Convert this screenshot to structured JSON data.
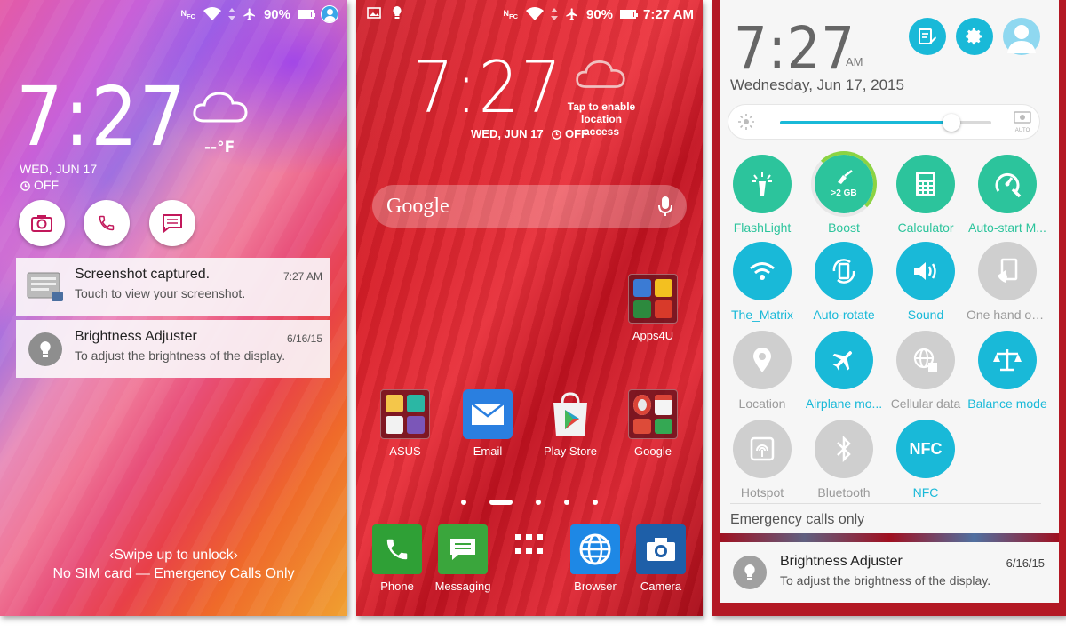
{
  "lockscreen": {
    "status": {
      "battery": "90%",
      "battery_level": 0.9
    },
    "clock": {
      "hour": "7",
      "minutes": "27"
    },
    "weather_temp": "--°F",
    "date": "WED, JUN 17",
    "alarm": "OFF",
    "quick_launch": [
      "camera-icon",
      "phone-icon",
      "message-icon"
    ],
    "notifications": [
      {
        "title": "Screenshot captured.",
        "subtitle": "Touch to view your screenshot.",
        "time": "7:27 AM"
      },
      {
        "title": "Brightness Adjuster",
        "subtitle": "To adjust the brightness of the display.",
        "time": "6/16/15"
      }
    ],
    "swipe_hint": "Swipe up to unlock",
    "sim_status": "No SIM card — Emergency Calls Only"
  },
  "homescreen": {
    "status": {
      "battery": "90%",
      "time": "7:27 AM",
      "battery_level": 0.9
    },
    "clock": {
      "hour": "7",
      "minutes": "27"
    },
    "weather_hint": [
      "Tap to enable",
      "location access"
    ],
    "date": "WED, JUN 17",
    "alarm": "OFF",
    "search_logo": "Google",
    "apps": {
      "apps4u": "Apps4U",
      "asus": "ASUS",
      "email": "Email",
      "play_store": "Play Store",
      "google": "Google"
    },
    "dock": {
      "phone": "Phone",
      "messaging": "Messaging",
      "browser": "Browser",
      "camera": "Camera"
    },
    "colors": {
      "phone": "#2fa036",
      "messaging": "#3aa63c",
      "browser": "#1e88e5",
      "camera": "#1e5fa8",
      "email": "#2a7fe0"
    }
  },
  "quicksettings": {
    "clock": "7:27",
    "ampm": "AM",
    "date": "Wednesday, Jun 17, 2015",
    "brightness_level": 0.81,
    "brightness_auto_label": "AUTO",
    "tiles": [
      {
        "label": "FlashLight"
      },
      {
        "label": "Boost",
        "ram": ">2 GB"
      },
      {
        "label": "Calculator"
      },
      {
        "label": "Auto-start M..."
      },
      {
        "label": "The_Matrix"
      },
      {
        "label": "Auto-rotate"
      },
      {
        "label": "Sound"
      },
      {
        "label": "One hand op..."
      },
      {
        "label": "Location"
      },
      {
        "label": "Airplane mo..."
      },
      {
        "label": "Cellular data"
      },
      {
        "label": "Balance mode"
      },
      {
        "label": "Hotspot"
      },
      {
        "label": "Bluetooth"
      },
      {
        "label": "NFC"
      }
    ],
    "emergency": "Emergency calls only",
    "notification": {
      "title": "Brightness Adjuster",
      "subtitle": "To adjust the brightness of the display.",
      "time": "6/16/15"
    },
    "colors": {
      "accent": "#19b9d8",
      "green": "#2cc49c",
      "off": "#cfcfcf"
    }
  }
}
